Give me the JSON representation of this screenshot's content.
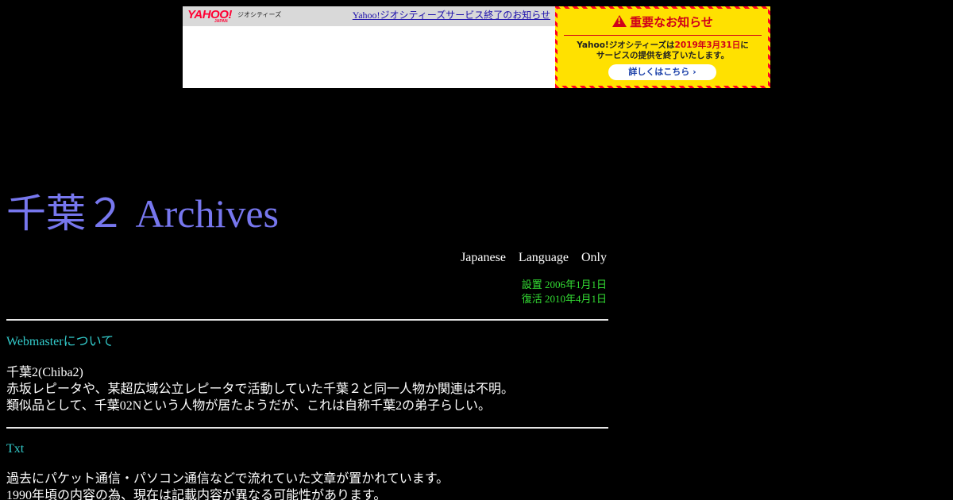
{
  "banner": {
    "logo_text": "YAHOO!",
    "logo_sub": "JAPAN",
    "service_name": "ジオシティーズ",
    "end_notice_link": "Yahoo!ジオシティーズサービス終了のお知らせ",
    "notice": {
      "title": "重要なお知らせ",
      "text_line1_prefix": "Yahoo!ジオシティーズは",
      "text_line1_date": "2019年3月31日",
      "text_line1_suffix": "に",
      "text_line2": "サービスの提供を終了いたします。",
      "button_label": "詳しくはこちら ›",
      "colors": {
        "stripe_red": "#ff0022",
        "stripe_yellow": "#ffe600",
        "accent": "#d0001a"
      }
    }
  },
  "site": {
    "title": "千葉２ Archives",
    "language_note": "Japanese Language Only",
    "established": "設置 2006年1月1日",
    "revived": "復活 2010年4月1日"
  },
  "sections": {
    "webmaster": {
      "heading": "Webmasterについて",
      "lines": [
        "千葉2(Chiba2)",
        "赤坂レピータや、某超広域公立レピータで活動していた千葉２と同一人物か関連は不明。",
        "類似品として、千葉02Nという人物が居たようだが、これは自称千葉2の弟子らしい。"
      ]
    },
    "txt": {
      "heading": "Txt",
      "lines": [
        "過去にパケット通信・パソコン通信などで流れていた文章が置かれています。",
        "1990年頃の内容の為、現在は記載内容が異なる可能性があります。"
      ]
    }
  },
  "colors": {
    "background": "#000000",
    "title": "#7777ee",
    "dates": "#33dd33",
    "links": "#33cccc",
    "body_text": "#ffffff"
  }
}
